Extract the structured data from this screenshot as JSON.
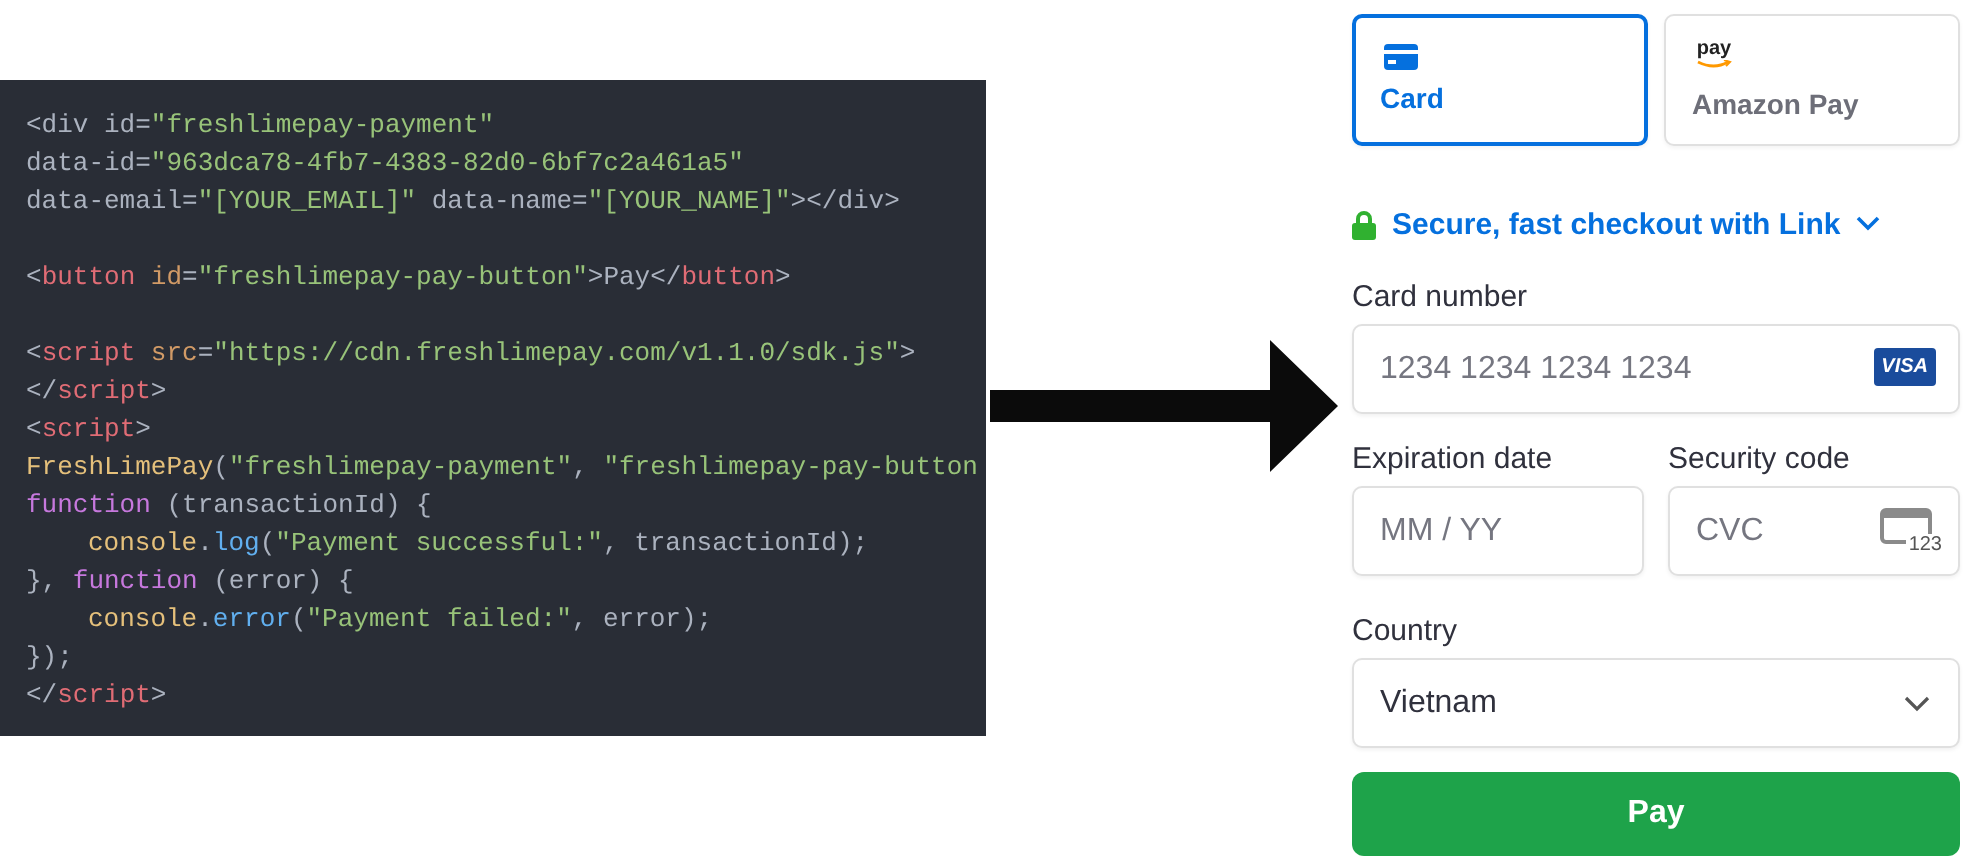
{
  "code_lines": [
    {
      "kind": "code",
      "indent": false,
      "tokens": [
        {
          "kind": "plain",
          "text": "<div id="
        },
        {
          "kind": "string",
          "text": "\"freshlimepay-payment\""
        }
      ]
    },
    {
      "kind": "code",
      "indent": false,
      "tokens": [
        {
          "kind": "plain",
          "text": "data-id="
        },
        {
          "kind": "string",
          "text": "\"963dca78-4fb7-4383-82d0-6bf7c2a461a5\""
        }
      ]
    },
    {
      "kind": "code",
      "indent": false,
      "tokens": [
        {
          "kind": "plain",
          "text": "data-email="
        },
        {
          "kind": "string",
          "text": "\"[YOUR_EMAIL]\""
        },
        {
          "kind": "plain",
          "text": " data-name="
        },
        {
          "kind": "string",
          "text": "\"[YOUR_NAME]\""
        },
        {
          "kind": "plain",
          "text": "></div>"
        }
      ]
    },
    {
      "kind": "blank"
    },
    {
      "kind": "code",
      "indent": false,
      "tokens": [
        {
          "kind": "plain",
          "text": "<"
        },
        {
          "kind": "tag",
          "text": "button"
        },
        {
          "kind": "attr",
          "text": " id"
        },
        {
          "kind": "plain",
          "text": "="
        },
        {
          "kind": "string",
          "text": "\"freshlimepay-pay-button\""
        },
        {
          "kind": "plain",
          "text": ">Pay</"
        },
        {
          "kind": "tag",
          "text": "button"
        },
        {
          "kind": "plain",
          "text": ">"
        }
      ]
    },
    {
      "kind": "blank"
    },
    {
      "kind": "code",
      "indent": false,
      "tokens": [
        {
          "kind": "plain",
          "text": "<"
        },
        {
          "kind": "tag",
          "text": "script"
        },
        {
          "kind": "attr",
          "text": " src"
        },
        {
          "kind": "plain",
          "text": "="
        },
        {
          "kind": "string",
          "text": "\"https://cdn.freshlimepay.com/v1.1.0/sdk.js\""
        },
        {
          "kind": "plain",
          "text": ">"
        }
      ]
    },
    {
      "kind": "code",
      "indent": false,
      "tokens": [
        {
          "kind": "plain",
          "text": "</"
        },
        {
          "kind": "tag",
          "text": "script"
        },
        {
          "kind": "plain",
          "text": ">"
        }
      ]
    },
    {
      "kind": "code",
      "indent": false,
      "tokens": [
        {
          "kind": "plain",
          "text": "<"
        },
        {
          "kind": "tag",
          "text": "script"
        },
        {
          "kind": "plain",
          "text": ">"
        }
      ]
    },
    {
      "kind": "code",
      "indent": false,
      "tokens": [
        {
          "kind": "func",
          "text": "FreshLimePay"
        },
        {
          "kind": "plain",
          "text": "("
        },
        {
          "kind": "string",
          "text": "\"freshlimepay-payment\""
        },
        {
          "kind": "plain",
          "text": ", "
        },
        {
          "kind": "string",
          "text": "\"freshlimepay-pay-button"
        }
      ]
    },
    {
      "kind": "code",
      "indent": false,
      "tokens": [
        {
          "kind": "keyword",
          "text": "function"
        },
        {
          "kind": "plain",
          "text": " (transactionId) {"
        }
      ]
    },
    {
      "kind": "code",
      "indent": true,
      "tokens": [
        {
          "kind": "func",
          "text": "console"
        },
        {
          "kind": "plain",
          "text": "."
        },
        {
          "kind": "method",
          "text": "log"
        },
        {
          "kind": "plain",
          "text": "("
        },
        {
          "kind": "string",
          "text": "\"Payment successful:\""
        },
        {
          "kind": "plain",
          "text": ", transactionId);"
        }
      ]
    },
    {
      "kind": "code",
      "indent": false,
      "tokens": [
        {
          "kind": "plain",
          "text": "}, "
        },
        {
          "kind": "keyword",
          "text": "function"
        },
        {
          "kind": "plain",
          "text": " (error) {"
        }
      ]
    },
    {
      "kind": "code",
      "indent": true,
      "tokens": [
        {
          "kind": "func",
          "text": "console"
        },
        {
          "kind": "plain",
          "text": "."
        },
        {
          "kind": "method",
          "text": "error"
        },
        {
          "kind": "plain",
          "text": "("
        },
        {
          "kind": "string",
          "text": "\"Payment failed:\""
        },
        {
          "kind": "plain",
          "text": ", error);"
        }
      ]
    },
    {
      "kind": "code",
      "indent": false,
      "tokens": [
        {
          "kind": "plain",
          "text": "});"
        }
      ]
    },
    {
      "kind": "code",
      "indent": false,
      "tokens": [
        {
          "kind": "plain",
          "text": "</"
        },
        {
          "kind": "tag",
          "text": "script"
        },
        {
          "kind": "plain",
          "text": ">"
        }
      ]
    }
  ],
  "payment": {
    "tabs": [
      {
        "kind": "card",
        "label": "Card",
        "selected": true
      },
      {
        "kind": "amazon",
        "label": "Amazon Pay",
        "logo_text": "pay",
        "selected": false
      }
    ],
    "link": {
      "text": "Secure, fast checkout with Link"
    },
    "card_number": {
      "label": "Card number",
      "placeholder": "1234 1234 1234 1234",
      "brand": "VISA"
    },
    "expiration": {
      "label": "Expiration date",
      "placeholder": "MM / YY"
    },
    "security_code": {
      "label": "Security code",
      "placeholder": "CVC",
      "icon_text": "123"
    },
    "country": {
      "label": "Country",
      "value": "Vietnam"
    },
    "pay_button": "Pay"
  }
}
